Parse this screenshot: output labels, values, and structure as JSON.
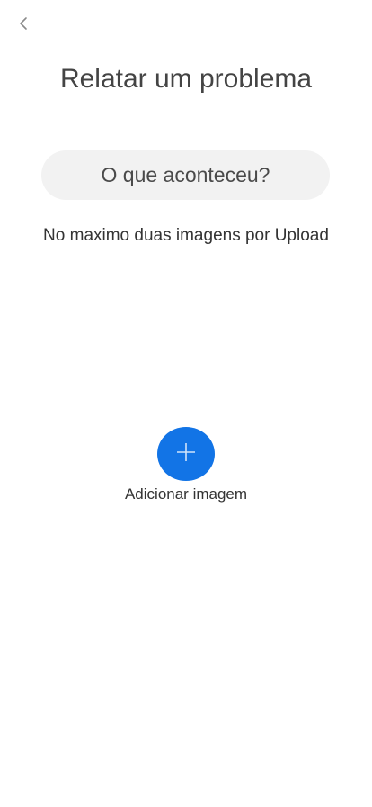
{
  "header": {
    "back_icon": "chevron-left-icon",
    "title": "Relatar um problema"
  },
  "form": {
    "what_happened_label": "O que aconteceu?",
    "upload_hint": "No maximo duas imagens por Upload"
  },
  "upload": {
    "add_icon": "plus-icon",
    "add_label": "Adicionar imagem"
  },
  "colors": {
    "accent": "#1274e6",
    "pill_background": "#f2f2f2",
    "text": "#444444"
  }
}
